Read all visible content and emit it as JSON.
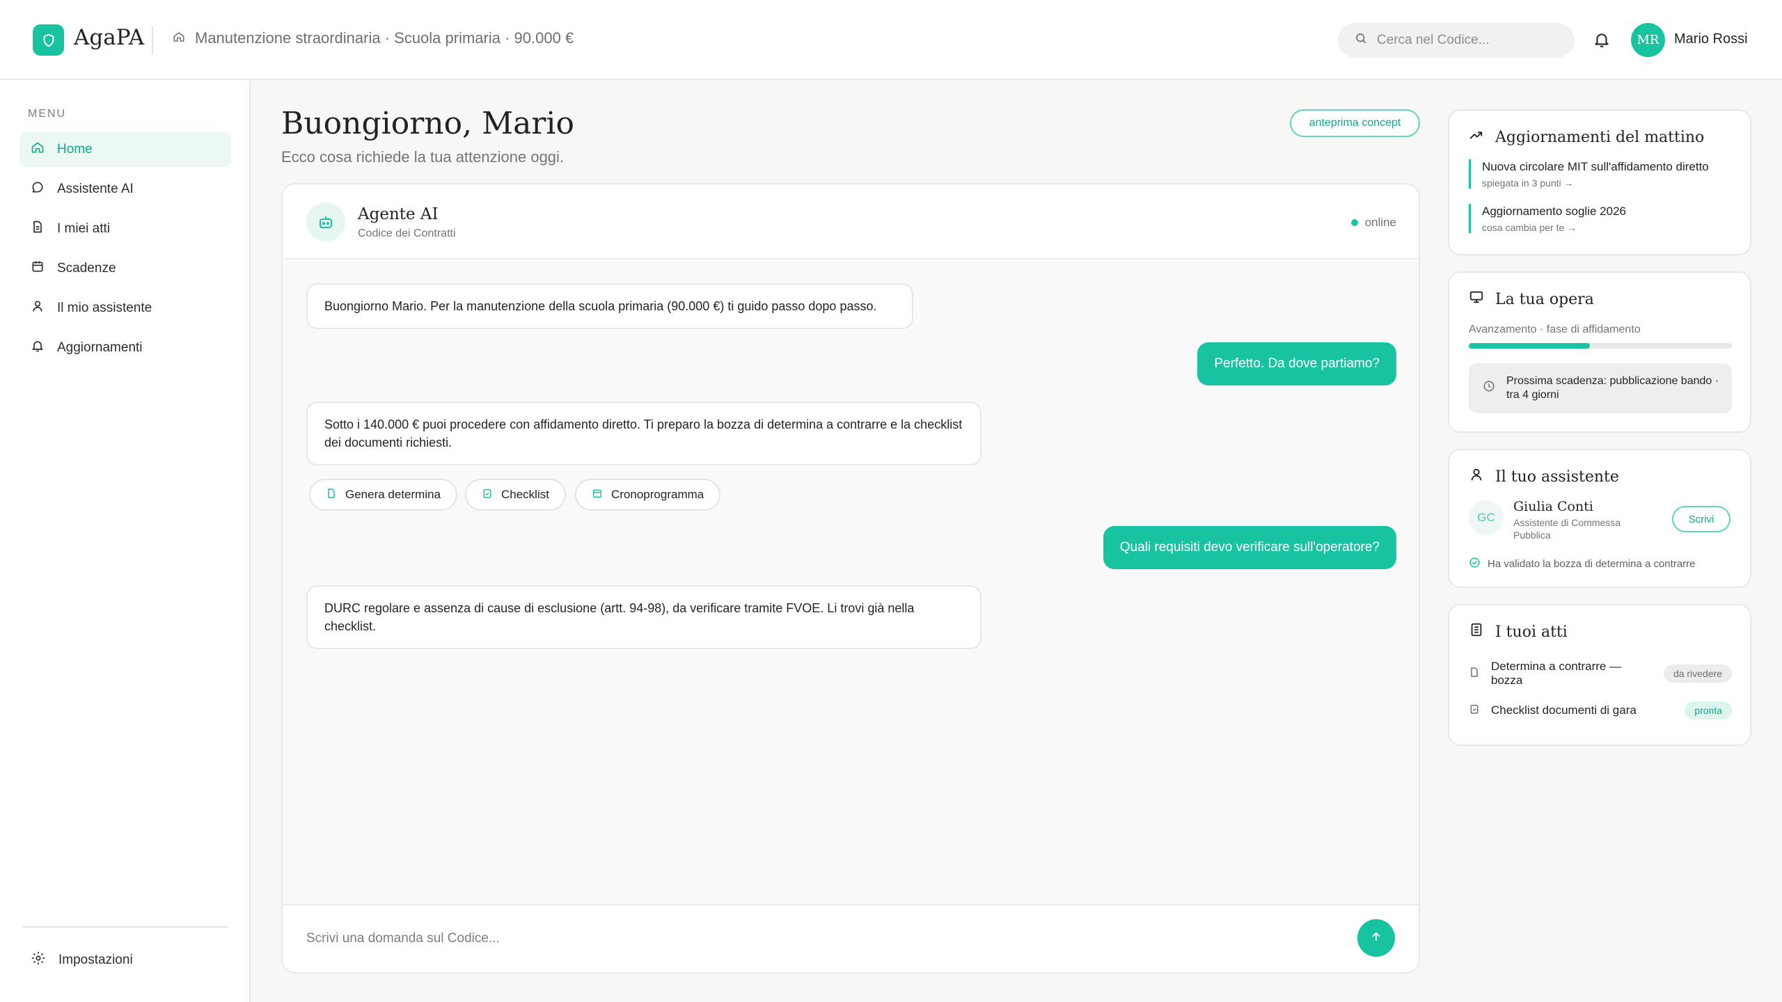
{
  "app": {
    "name": "AgaPA"
  },
  "breadcrumb": {
    "text": "Manutenzione straordinaria · Scuola primaria · 90.000 €"
  },
  "search": {
    "placeholder": "Cerca nel Codice..."
  },
  "user": {
    "initials": "MR",
    "name": "Mario Rossi"
  },
  "sidebar": {
    "menu_label": "MENU",
    "items": [
      {
        "label": "Home",
        "icon": "home-icon",
        "active": true
      },
      {
        "label": "Assistente AI",
        "icon": "chat-icon"
      },
      {
        "label": "I miei atti",
        "icon": "document-icon"
      },
      {
        "label": "Scadenze",
        "icon": "calendar-icon"
      },
      {
        "label": "Il mio assistente",
        "icon": "user-icon"
      },
      {
        "label": "Aggiornamenti",
        "icon": "bell-icon"
      }
    ],
    "settings_label": "Impostazioni"
  },
  "main": {
    "greeting": "Buongiorno, Mario",
    "subtitle": "Ecco cosa richiede la tua attenzione oggi.",
    "badge": "anteprima concept"
  },
  "chat": {
    "agent_name": "Agente AI",
    "agent_subtitle": "Codice dei Contratti",
    "status": "online",
    "messages": [
      {
        "from": "ai",
        "text": "Buongiorno Mario. Per la manutenzione della scuola primaria (90.000 €) ti guido passo dopo passo."
      },
      {
        "from": "user",
        "text": "Perfetto. Da dove partiamo?"
      },
      {
        "from": "ai",
        "text": "Sotto i 140.000 € puoi procedere con affidamento diretto. Ti preparo la bozza di determina a contrarre e la checklist dei documenti richiesti."
      },
      {
        "from": "user",
        "text": "Quali requisiti devo verificare sull'operatore?"
      },
      {
        "from": "ai",
        "text": "DURC regolare e assenza di cause di esclusione (artt. 94-98), da verificare tramite FVOE. Li trovi già nella checklist."
      }
    ],
    "actions": [
      {
        "label": "Genera determina",
        "icon": "document-icon"
      },
      {
        "label": "Checklist",
        "icon": "checklist-icon"
      },
      {
        "label": "Cronoprogramma",
        "icon": "calendar-icon"
      }
    ],
    "input_placeholder": "Scrivi una domanda sul Codice..."
  },
  "panels": {
    "updates": {
      "title": "Aggiornamenti del mattino",
      "items": [
        {
          "title": "Nuova circolare MIT sull'affidamento diretto",
          "sub": "spiegata in 3 punti →"
        },
        {
          "title": "Aggiornamento soglie 2026",
          "sub": "cosa cambia per te →"
        }
      ]
    },
    "work": {
      "title": "La tua opera",
      "progress_label": "Avanzamento · fase di affidamento",
      "progress": 0.46,
      "deadline": "Prossima scadenza: pubblicazione bando · tra 4 giorni"
    },
    "assistant": {
      "title": "Il tuo assistente",
      "initials": "GC",
      "name": "Giulia Conti",
      "role": "Assistente di Commessa Pubblica",
      "write_label": "Scrivi",
      "note": "Ha validato la bozza di determina a contrarre"
    },
    "acts": {
      "title": "I tuoi atti",
      "items": [
        {
          "name": "Determina a contrarre — bozza",
          "status": "da rivedere"
        },
        {
          "name": "Checklist documenti di gara",
          "status": "pronta"
        }
      ]
    }
  },
  "colors": {
    "accent": "#17c3a0",
    "accent_dark": "#12a888"
  }
}
